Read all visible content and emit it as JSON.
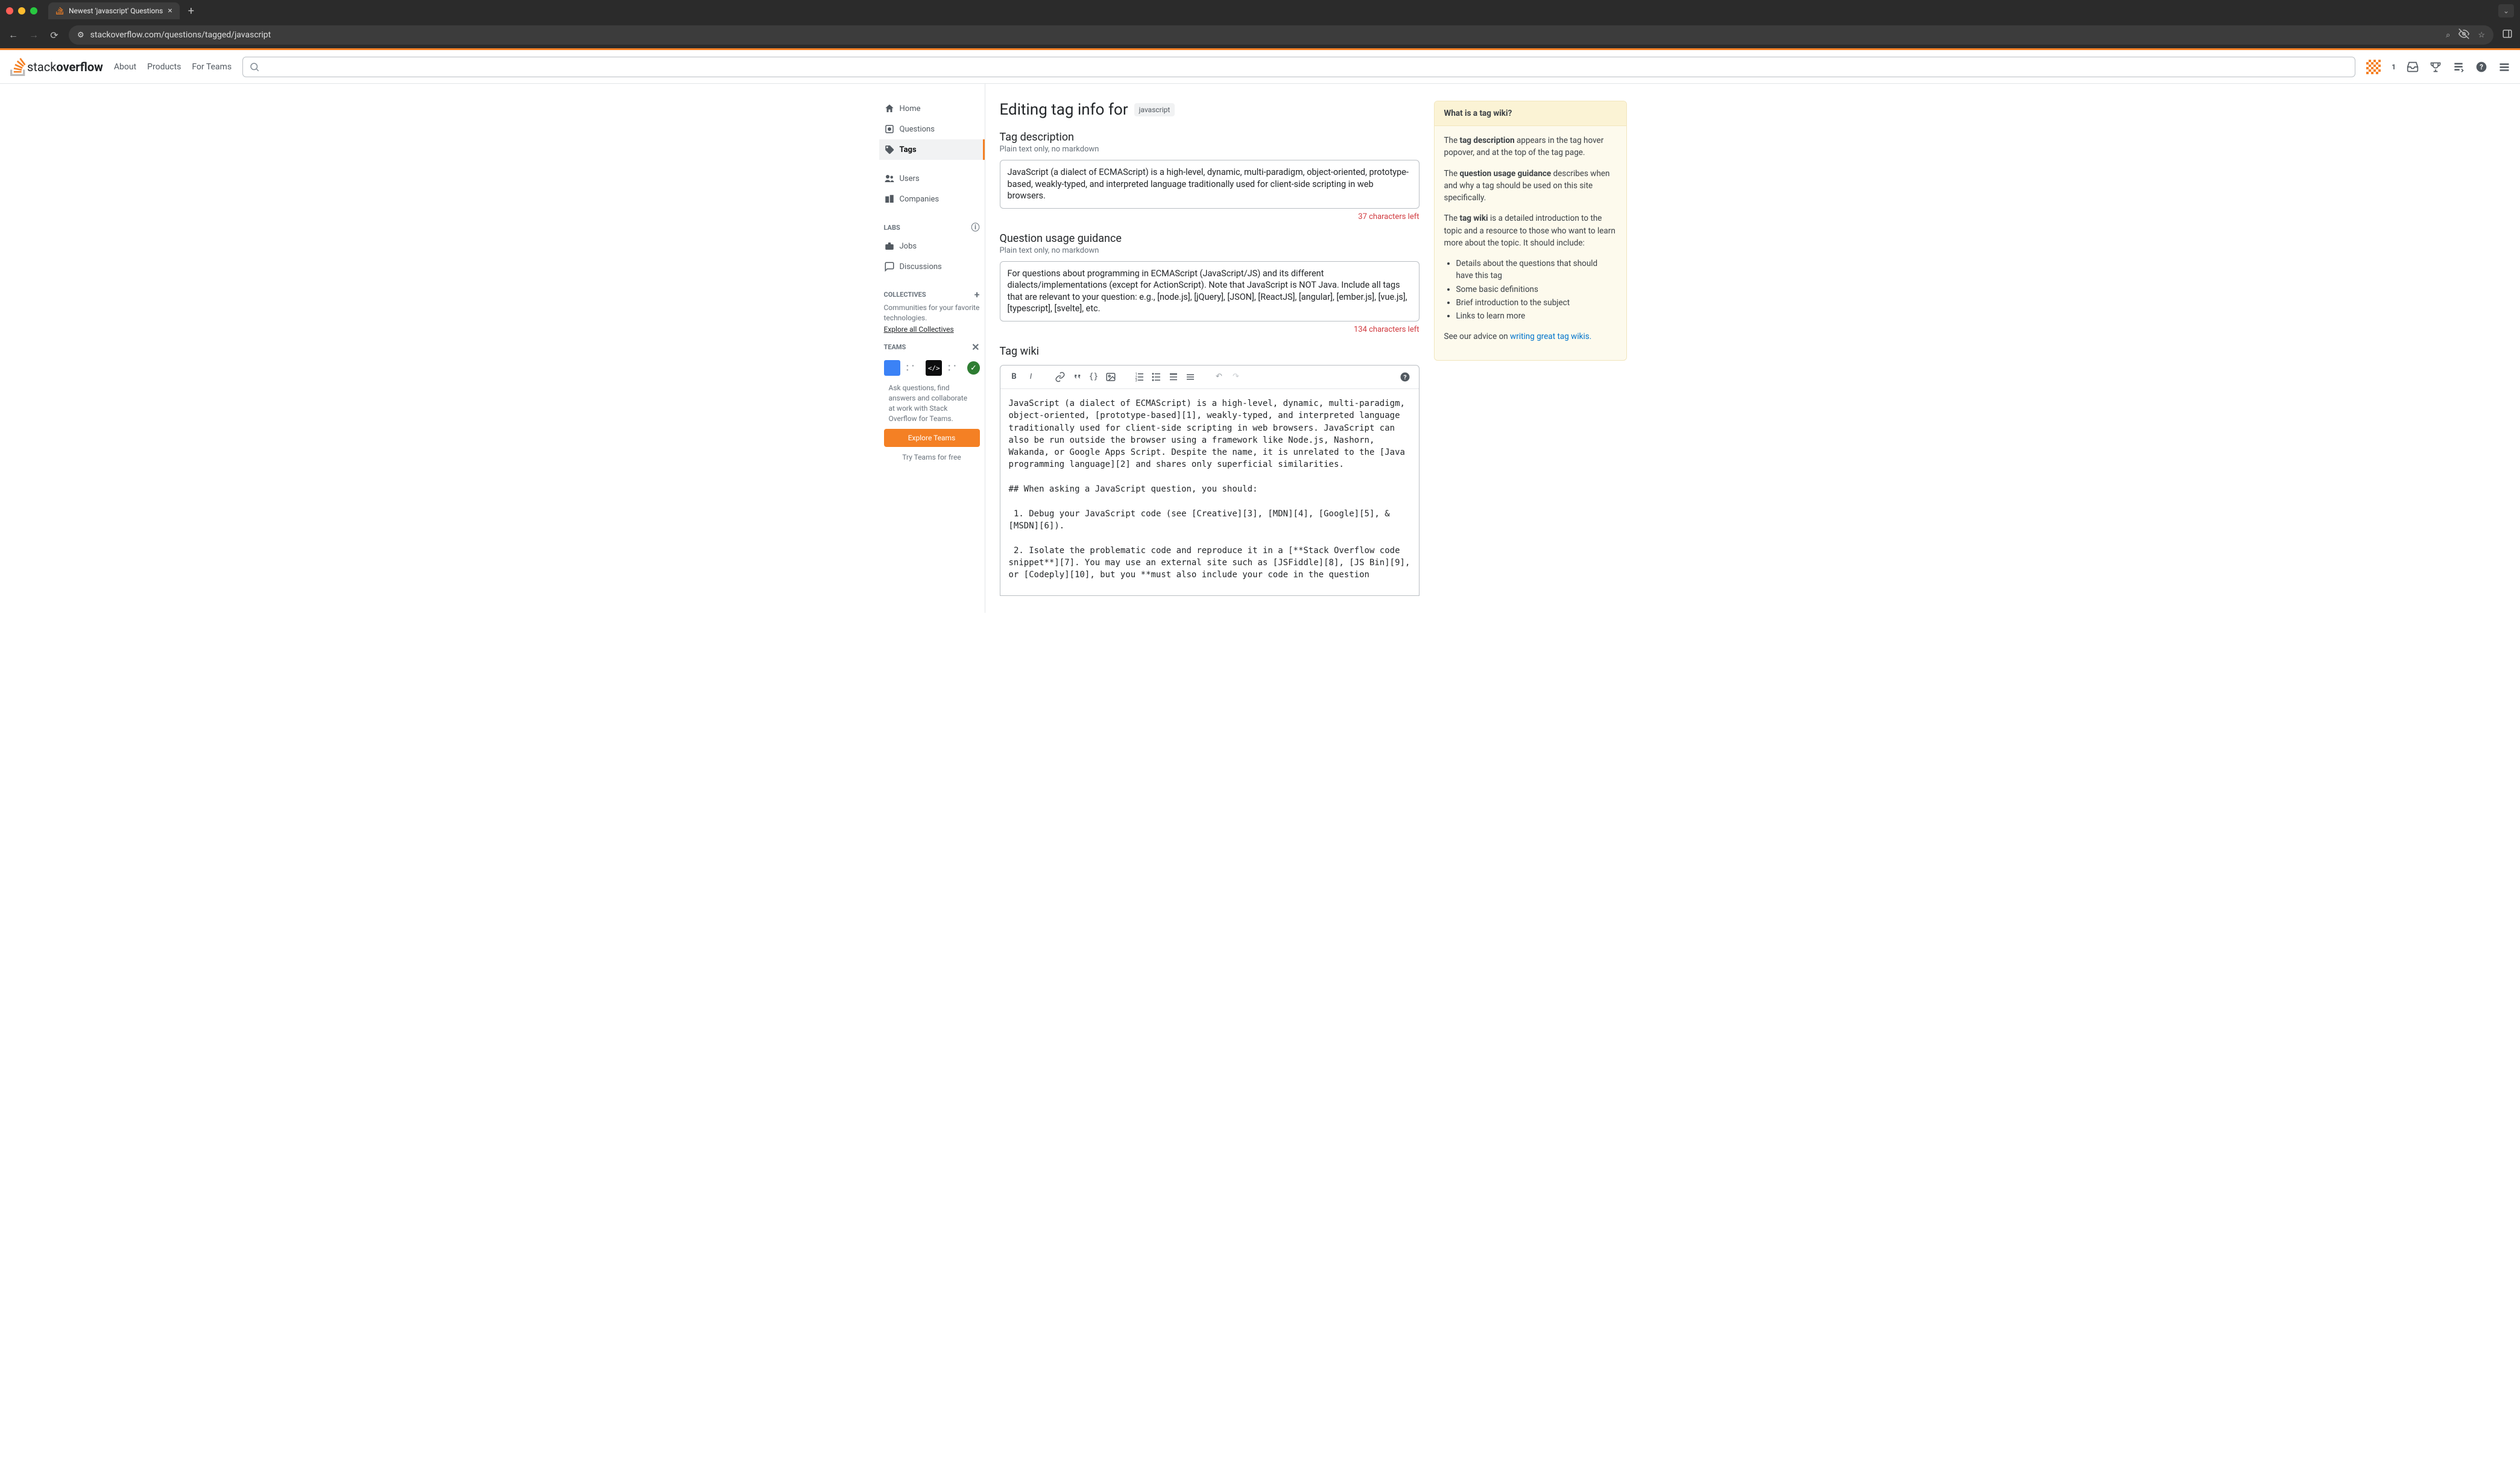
{
  "browser": {
    "tab_title": "Newest 'javascript' Questions",
    "url": "stackoverflow.com/questions/tagged/javascript"
  },
  "header": {
    "logo_part1": "stack",
    "logo_part2": "overflow",
    "nav": {
      "about": "About",
      "products": "Products",
      "teams": "For Teams"
    },
    "search_placeholder": "",
    "reputation": "1"
  },
  "sidebar": {
    "items": [
      {
        "icon": "home",
        "label": "Home"
      },
      {
        "icon": "questions",
        "label": "Questions"
      },
      {
        "icon": "tags",
        "label": "Tags"
      },
      {
        "icon": "users",
        "label": "Users"
      },
      {
        "icon": "companies",
        "label": "Companies"
      }
    ],
    "active_index": 2,
    "labs_title": "LABS",
    "jobs": "Jobs",
    "discussions": "Discussions",
    "collectives_title": "COLLECTIVES",
    "collectives_desc": "Communities for your favorite technologies.",
    "collectives_link": "Explore all Collectives",
    "teams_title": "TEAMS",
    "teams_desc": "Ask questions, find answers and collaborate at work with Stack Overflow for Teams.",
    "explore_teams": "Explore Teams",
    "try_free": "Try Teams for free"
  },
  "main": {
    "heading_prefix": "Editing tag info for",
    "tag": "javascript",
    "tag_description": {
      "title": "Tag description",
      "subtitle": "Plain text only, no markdown",
      "value": "JavaScript (a dialect of ECMAScript) is a high-level, dynamic, multi-paradigm, object-oriented, prototype-based, weakly-typed, and interpreted language traditionally used for client-side scripting in web browsers.",
      "chars_left": "37 characters left"
    },
    "usage_guidance": {
      "title": "Question usage guidance",
      "subtitle": "Plain text only, no markdown",
      "value": "For questions about programming in ECMAScript (JavaScript/JS) and its different dialects/implementations (except for ActionScript). Note that JavaScript is NOT Java. Include all tags that are relevant to your question: e.g., [node.js], [jQuery], [JSON], [ReactJS], [angular], [ember.js], [vue.js], [typescript], [svelte], etc.",
      "chars_left": "134 characters left"
    },
    "tag_wiki": {
      "title": "Tag wiki",
      "body": "JavaScript (a dialect of ECMAScript) is a high-level, dynamic, multi-paradigm, object-oriented, [prototype-based][1], weakly-typed, and interpreted language traditionally used for client-side scripting in web browsers. JavaScript can also be run outside the browser using a framework like Node.js, Nashorn, Wakanda, or Google Apps Script. Despite the name, it is unrelated to the [Java programming language][2] and shares only superficial similarities.\n\n## When asking a JavaScript question, you should:\n\n 1. Debug your JavaScript code (see [Creative][3], [MDN][4], [Google][5], & [MSDN][6]).\n\n 2. Isolate the problematic code and reproduce it in a [**Stack Overflow code snippet**][7]. You may use an external site such as [JSFiddle][8], [JS Bin][9], or [Codeply][10], but you **must also include your code in the question"
    }
  },
  "aside": {
    "title": "What is a tag wiki?",
    "p1a": "The ",
    "p1b": "tag description",
    "p1c": " appears in the tag hover popover, and at the top of the tag page.",
    "p2a": "The ",
    "p2b": "question usage guidance",
    "p2c": " describes when and why a tag should be used on this site specifically.",
    "p3a": "The ",
    "p3b": "tag wiki",
    "p3c": " is a detailed introduction to the topic and a resource to those who want to learn more about the topic. It should include:",
    "bullets": [
      "Details about the questions that should have this tag",
      "Some basic definitions",
      "Brief introduction to the subject",
      "Links to learn more"
    ],
    "advice_prefix": "See our advice on ",
    "advice_link": "writing great tag wikis."
  }
}
